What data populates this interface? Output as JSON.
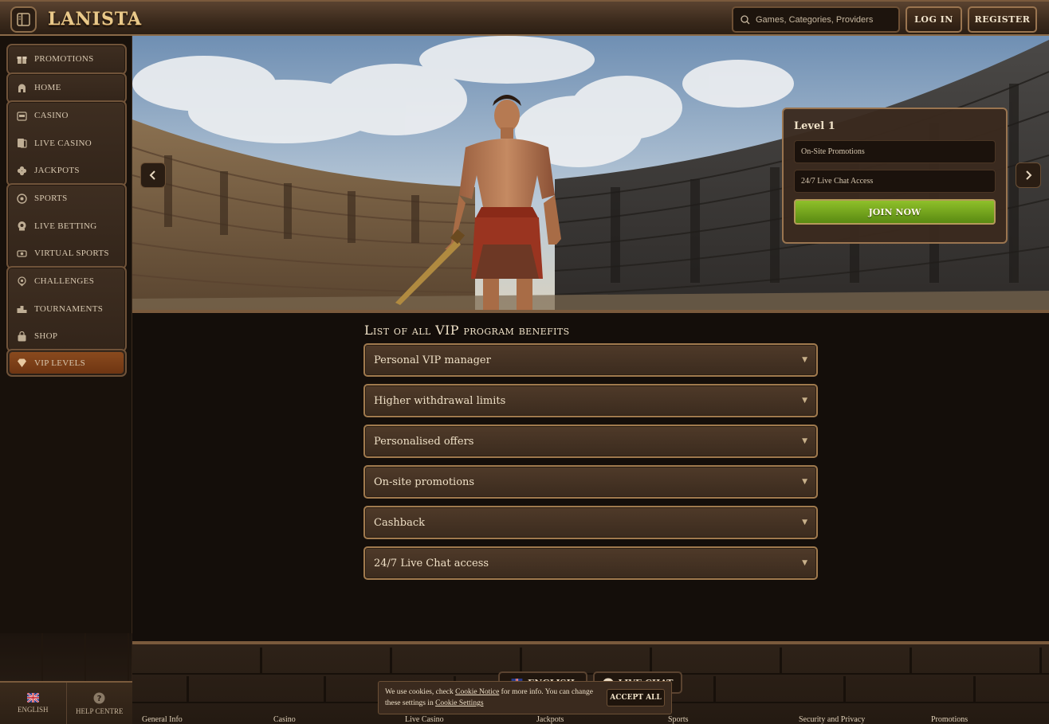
{
  "header": {
    "logo_text": "LANISTA",
    "search_placeholder": "Games, Categories, Providers",
    "login_label": "LOG IN",
    "register_label": "REGISTER"
  },
  "sidebar": {
    "groups": [
      {
        "items": [
          {
            "label": "PROMOTIONS",
            "icon": "gift-icon"
          }
        ]
      },
      {
        "items": [
          {
            "label": "HOME",
            "icon": "helmet-icon"
          }
        ]
      },
      {
        "items": [
          {
            "label": "CASINO",
            "icon": "slot-machine-icon"
          },
          {
            "label": "LIVE CASINO",
            "icon": "cards-icon"
          },
          {
            "label": "JACKPOTS",
            "icon": "clover-icon"
          }
        ]
      },
      {
        "items": [
          {
            "label": "SPORTS",
            "icon": "ball-icon"
          },
          {
            "label": "LIVE BETTING",
            "icon": "live-icon"
          },
          {
            "label": "VIRTUAL SPORTS",
            "icon": "virtual-icon"
          }
        ]
      },
      {
        "items": [
          {
            "label": "CHALLENGES",
            "icon": "target-icon"
          },
          {
            "label": "TOURNAMENTS",
            "icon": "podium-icon"
          },
          {
            "label": "SHOP",
            "icon": "bag-icon"
          }
        ]
      },
      {
        "items": [
          {
            "label": "VIP LEVELS",
            "icon": "diamond-icon",
            "active": true
          }
        ]
      }
    ],
    "footer": {
      "language_label": "ENGLISH",
      "help_label": "HELP CENTRE"
    }
  },
  "hero": {
    "level_title": "Level 1",
    "perks": [
      "On-Site Promotions",
      "24/7 Live Chat Access"
    ],
    "cta_label": "JOIN NOW"
  },
  "main": {
    "title": "List of all VIP program benefits",
    "benefits": [
      "Personal VIP manager",
      "Higher withdrawal limits",
      "Personalised offers",
      "On-site promotions",
      "Cashback",
      "24/7 Live Chat access"
    ]
  },
  "footer": {
    "language_button": "ENGLISH",
    "livechat_button": "LIVE CHAT",
    "links": [
      "General Info",
      "Casino",
      "Live Casino",
      "Jackpots",
      "Sports",
      "Security and Privacy",
      "Promotions"
    ]
  },
  "cookie": {
    "text_before": "We use cookies, check ",
    "notice_link": "Cookie Notice",
    "text_middle": " for more info. You can change these settings in ",
    "settings_link": "Cookie Settings",
    "accept_label": "ACCEPT ALL"
  },
  "colors": {
    "accent_green": "#7cb21f",
    "active_nav": "#8a4a1e",
    "border_gold": "#a07a4e"
  }
}
